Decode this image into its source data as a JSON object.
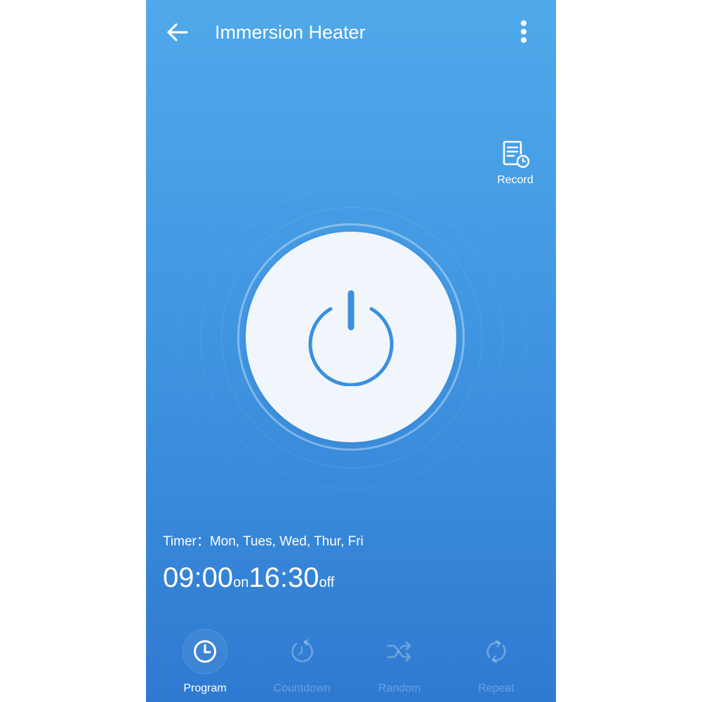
{
  "header": {
    "title": "Immersion Heater",
    "back_icon": "arrow-left-icon",
    "menu_icon": "more-vertical-icon"
  },
  "record": {
    "label": "Record",
    "icon": "record-document-clock-icon"
  },
  "power": {
    "icon": "power-icon"
  },
  "timer": {
    "label": "Timer：",
    "days": "Mon, Tues, Wed, Thur, Fri",
    "on_time": "09:00",
    "on_label": "on",
    "off_time": "16:30",
    "off_label": "off"
  },
  "nav": {
    "items": [
      {
        "label": "Program",
        "icon": "clock-icon",
        "active": true
      },
      {
        "label": "Countdown",
        "icon": "countdown-icon",
        "active": false
      },
      {
        "label": "Random",
        "icon": "shuffle-icon",
        "active": false
      },
      {
        "label": "Repeat",
        "icon": "repeat-icon",
        "active": false
      }
    ]
  },
  "colors": {
    "background_top": "#4fa9ea",
    "background_bottom": "#2f7ad1",
    "power_button": "#f1f6fc",
    "power_icon": "#3a8fe0",
    "text": "#ffffff"
  }
}
